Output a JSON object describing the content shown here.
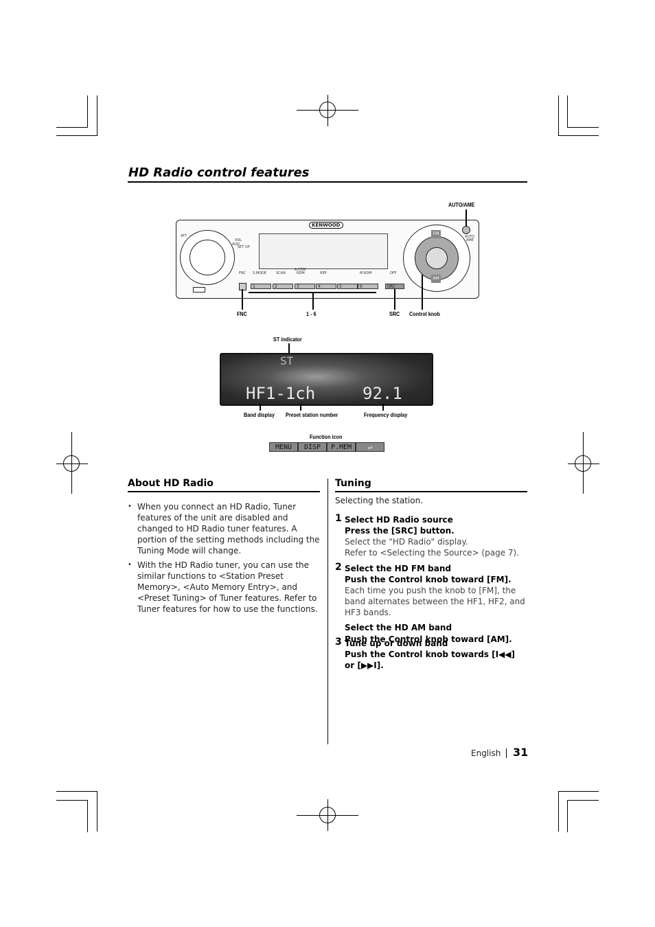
{
  "title": "HD Radio control features",
  "device": {
    "brand": "KENWOOD",
    "callouts": {
      "auto_ame": "AUTO/AME",
      "fnc": "FNC",
      "presets": "1 - 6",
      "src": "SRC",
      "control_knob": "Control knob"
    },
    "panel_labels": {
      "att": "ATT",
      "vol": "VOL",
      "aud": "AUD",
      "setup": "SET UP",
      "fnc": "FNC",
      "smode": "S.MODE",
      "scan": "SCAN",
      "acdm": "A.CDM",
      "rdm": "RDM",
      "rep": "REP",
      "mrdm": "M.RDM",
      "off": "OFF",
      "fm": "FM",
      "am": "AM",
      "src": "SRC",
      "auto": "AUTO",
      "ame": "AME"
    },
    "preset_buttons": [
      "1",
      "2",
      "3",
      "4",
      "5",
      "6"
    ]
  },
  "display": {
    "st": "ST",
    "band": "HF1-1ch",
    "frequency": "92.1",
    "callouts": {
      "st_indicator": "ST indicator",
      "band_display": "Band display",
      "preset_number": "Preset station number",
      "frequency_display": "Frequency display",
      "function_icon": "Function icon"
    },
    "function_icons": [
      "MENU",
      "DISP",
      "P.MEM",
      "↵"
    ]
  },
  "about": {
    "heading": "About HD Radio",
    "bullets": [
      "When you connect an HD Radio, Tuner features of the unit are disabled and changed to HD Radio tuner features. A portion of the setting methods including the Tuning Mode will change.",
      "With the HD Radio tuner, you can use the similar functions to <Station Preset Memory>, <Auto Memory Entry>, and <Preset Tuning> of Tuner features. Refer to Tuner features for how to use the functions."
    ]
  },
  "tuning": {
    "heading": "Tuning",
    "intro": "Selecting the station.",
    "steps": [
      {
        "num": "1",
        "title": "Select HD Radio source",
        "action": "Press the [SRC] button.",
        "notes": [
          "Select the \"HD Radio\" display.",
          "Refer to <Selecting the Source> (page 7)."
        ]
      },
      {
        "num": "2",
        "title": "Select the HD FM band",
        "action": "Push the Control knob toward [FM].",
        "notes": [
          "Each time you push the knob to [FM], the band alternates between the HF1, HF2, and HF3 bands."
        ],
        "title2": "Select the HD AM band",
        "action2": "Push the Control knob toward [AM]."
      },
      {
        "num": "3",
        "title": "Tune up or down band",
        "action": "Push the Control knob towards [I◀◀] or [▶▶I]."
      }
    ]
  },
  "footer": {
    "language": "English",
    "page": "31"
  }
}
